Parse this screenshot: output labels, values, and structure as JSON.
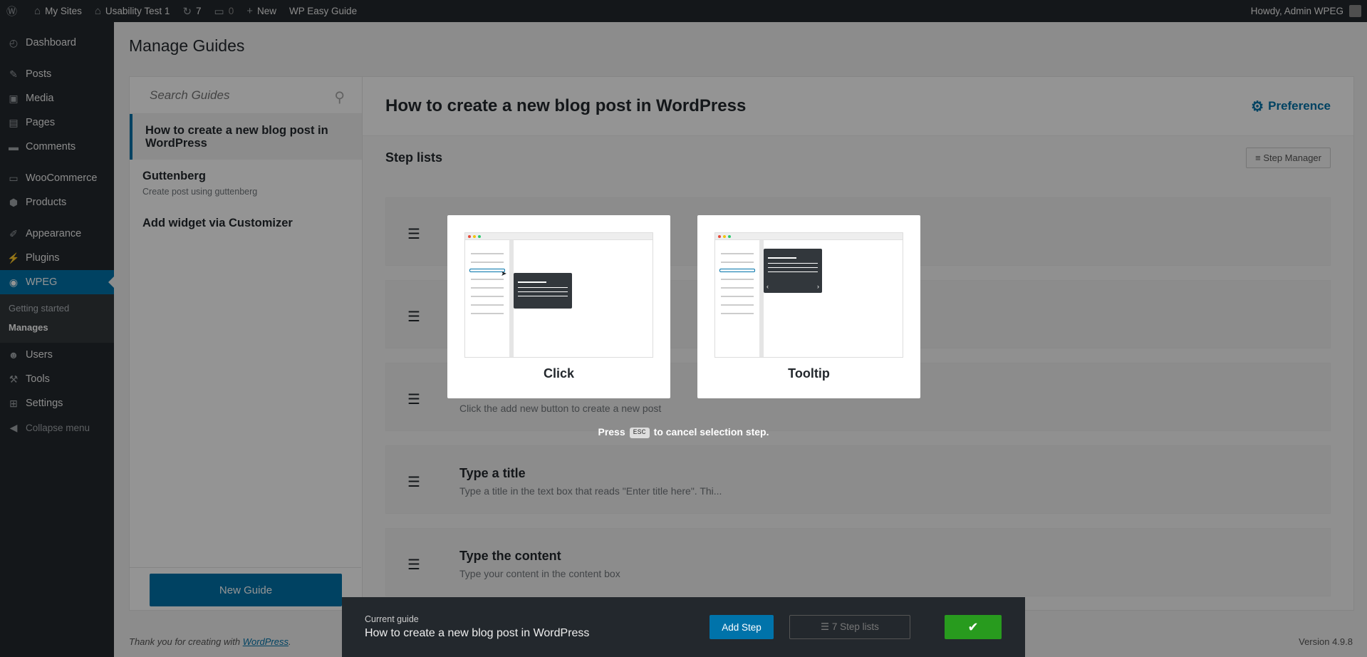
{
  "adminbar": {
    "wp_logo": "wordpress-logo-icon",
    "my_sites": "My Sites",
    "site_name": "Usability Test 1",
    "updates_count": "7",
    "comments_count": "0",
    "new_label": "New",
    "plugin_label": "WP Easy Guide",
    "howdy": "Howdy, Admin WPEG"
  },
  "menu": {
    "dashboard": "Dashboard",
    "posts": "Posts",
    "media": "Media",
    "pages": "Pages",
    "comments": "Comments",
    "woocommerce": "WooCommerce",
    "products": "Products",
    "appearance": "Appearance",
    "plugins": "Plugins",
    "wpeg": "WPEG",
    "sub_getting_started": "Getting started",
    "sub_manages": "Manages",
    "users": "Users",
    "tools": "Tools",
    "settings": "Settings",
    "collapse": "Collapse menu"
  },
  "page": {
    "title": "Manage Guides",
    "search_placeholder": "Search Guides",
    "new_guide": "New Guide"
  },
  "guides": [
    {
      "title": "How to create a new blog post in WordPress",
      "subtitle": ""
    },
    {
      "title": "Guttenberg",
      "subtitle": "Create post using guttenberg"
    },
    {
      "title": "Add widget via Customizer",
      "subtitle": ""
    }
  ],
  "detail": {
    "title": "How to create a new blog post in WordPress",
    "preference": "Preference",
    "step_lists_heading": "Step lists",
    "step_manager": "≡ Step Manager"
  },
  "steps": [
    {
      "title": "",
      "desc": "Click the add new button to create a new post"
    },
    {
      "title": "Type a title",
      "desc": "Type a title in the text box that reads \"Enter title here\". Thi..."
    },
    {
      "title": "Type the content",
      "desc": "Type your content in the content box"
    }
  ],
  "overlay": {
    "choice_click": "Click",
    "choice_tooltip": "Tooltip",
    "esc_press": "Press",
    "esc_key": "ESC",
    "esc_rest": "to cancel selection step."
  },
  "bottombar": {
    "current_label": "Current guide",
    "current_title": "How to create a new blog post in WordPress",
    "add_step": "Add Step",
    "step_lists": "7 Step lists"
  },
  "footer": {
    "thanks_prefix": "Thank you for creating with ",
    "thanks_link": "WordPress",
    "thanks_suffix": ".",
    "version": "Version 4.9.8"
  },
  "colors": {
    "accent": "#0073aa",
    "confirm": "#289b1e",
    "adminbar": "#23282d"
  }
}
